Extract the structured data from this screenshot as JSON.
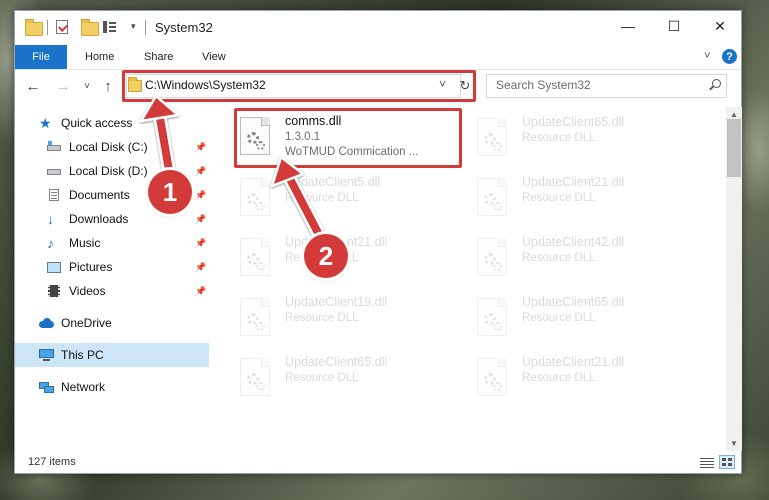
{
  "window": {
    "title": "System32",
    "controls": {
      "minimize": "—",
      "maximize": "☐",
      "close": "✕"
    }
  },
  "ribbon": {
    "file": "File",
    "tabs": [
      "Home",
      "Share",
      "View"
    ],
    "expand_icon": "chevron-down-icon",
    "help_icon": "help-icon"
  },
  "navigation": {
    "back": "←",
    "forward": "→",
    "recent": "˅",
    "up": "↑"
  },
  "address_bar": {
    "path": "C:\\Windows\\System32",
    "refresh": "↻",
    "dropdown": "˅"
  },
  "search": {
    "placeholder": "Search System32",
    "icon": "search-icon"
  },
  "sidebar": {
    "items": [
      {
        "label": "Quick access",
        "icon": "star-icon",
        "pinned": false
      },
      {
        "label": "Local Disk (C:)",
        "icon": "drive-icon",
        "pinned": true
      },
      {
        "label": "Local Disk (D:)",
        "icon": "drive-icon",
        "pinned": true
      },
      {
        "label": "Documents",
        "icon": "documents-icon",
        "pinned": true
      },
      {
        "label": "Downloads",
        "icon": "download-icon",
        "pinned": true
      },
      {
        "label": "Music",
        "icon": "music-icon",
        "pinned": true
      },
      {
        "label": "Pictures",
        "icon": "pictures-icon",
        "pinned": true
      },
      {
        "label": "Videos",
        "icon": "videos-icon",
        "pinned": true
      },
      {
        "label": "OneDrive",
        "icon": "cloud-icon",
        "pinned": false
      },
      {
        "label": "This PC",
        "icon": "computer-icon",
        "pinned": false,
        "selected": true
      },
      {
        "label": "Network",
        "icon": "network-icon",
        "pinned": false
      }
    ],
    "pin_glyph": "📌"
  },
  "files": {
    "highlighted": {
      "name": "comms.dll",
      "version": "1.3.0.1",
      "description": "WoTMUD Commication ..."
    },
    "left_column": [
      {
        "name": "UpdateClient5.dll",
        "description": "Resource DLL"
      },
      {
        "name": "UpdateClient21.dll",
        "description": "Resource DLL"
      },
      {
        "name": "UpdateClient19.dll",
        "description": "Resource DLL"
      },
      {
        "name": "UpdateClient65.dll",
        "description": "Resource DLL"
      }
    ],
    "right_column": [
      {
        "name": "UpdateClient65.dll",
        "description": "Resource DLL"
      },
      {
        "name": "UpdateClient21.dll",
        "description": "Resource DLL"
      },
      {
        "name": "UpdateClient42.dll",
        "description": "Resource DLL"
      },
      {
        "name": "UpdateClient65.dll",
        "description": "Resource DLL"
      },
      {
        "name": "UpdateClient21.dll",
        "description": "Resource DLL"
      }
    ]
  },
  "status_bar": {
    "item_count": "127 items"
  },
  "annotations": {
    "step1": "1",
    "step2": "2",
    "color": "#d33b3b"
  }
}
